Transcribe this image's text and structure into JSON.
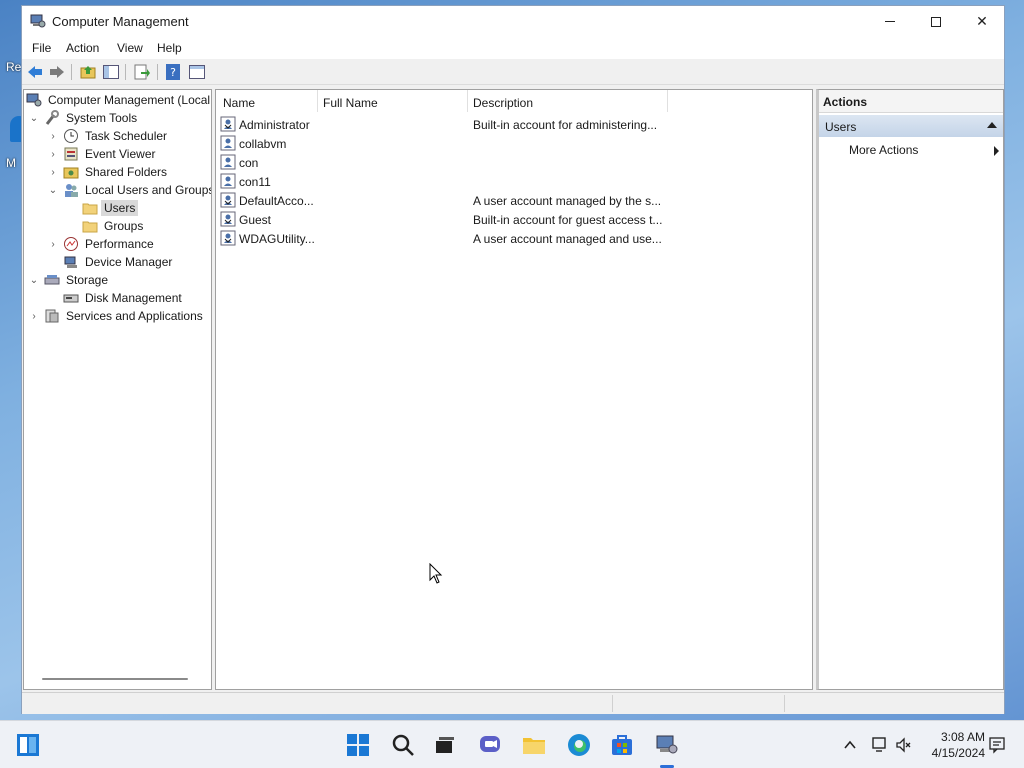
{
  "window": {
    "title": "Computer Management"
  },
  "desktop": {
    "label_top": "Re",
    "label_mid": "M"
  },
  "menu": {
    "file": "File",
    "action": "Action",
    "view": "View",
    "help": "Help"
  },
  "tree": {
    "root": "Computer Management (Local",
    "system_tools": "System Tools",
    "task_scheduler": "Task Scheduler",
    "event_viewer": "Event Viewer",
    "shared_folders": "Shared Folders",
    "local_users_groups": "Local Users and Groups",
    "users": "Users",
    "groups": "Groups",
    "performance": "Performance",
    "device_manager": "Device Manager",
    "storage": "Storage",
    "disk_management": "Disk Management",
    "services_apps": "Services and Applications"
  },
  "list": {
    "columns": {
      "name": "Name",
      "full_name": "Full Name",
      "description": "Description"
    },
    "rows": [
      {
        "name": "Administrator",
        "full_name": "",
        "description": "Built-in account for administering..."
      },
      {
        "name": "collabvm",
        "full_name": "",
        "description": ""
      },
      {
        "name": "con",
        "full_name": "",
        "description": ""
      },
      {
        "name": "con11",
        "full_name": "",
        "description": ""
      },
      {
        "name": "DefaultAcco...",
        "full_name": "",
        "description": "A user account managed by the s..."
      },
      {
        "name": "Guest",
        "full_name": "",
        "description": "Built-in account for guest access t..."
      },
      {
        "name": "WDAGUtility...",
        "full_name": "",
        "description": "A user account managed and use..."
      }
    ]
  },
  "actions": {
    "header": "Actions",
    "group": "Users",
    "more_actions": "More Actions"
  },
  "taskbar": {
    "time": "3:08 AM",
    "date": "4/15/2024"
  },
  "colors": {
    "accent": "#2c6fd8",
    "selection": "#d9d9d9",
    "actions_group": "#c4d4e8"
  }
}
